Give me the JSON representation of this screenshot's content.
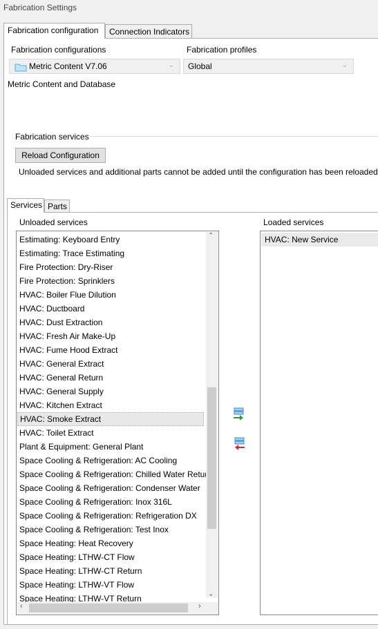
{
  "window": {
    "title": "Fabrication Settings"
  },
  "tabs": [
    "Fabrication configuration",
    "Connection Indicators"
  ],
  "config": {
    "configurations_label": "Fabrication configurations",
    "configuration_value": "Metric Content V7.06",
    "profiles_label": "Fabrication profiles",
    "profile_value": "Global",
    "description": "Metric Content and Database"
  },
  "services_group": {
    "label": "Fabrication services",
    "reload_button": "Reload Configuration",
    "note": "Unloaded services and additional parts cannot be added until the configuration has been reloaded"
  },
  "sub_tabs": [
    "Services",
    "Parts"
  ],
  "unloaded": {
    "label": "Unloaded services",
    "items": [
      "Estimating: Keyboard Entry",
      "Estimating: Trace Estimating",
      "Fire Protection: Dry-Riser",
      "Fire Protection: Sprinklers",
      "HVAC: Boiler Flue Dilution",
      "HVAC: Ductboard",
      "HVAC: Dust Extraction",
      "HVAC: Fresh Air Make-Up",
      "HVAC: Fume Hood Extract",
      "HVAC: General Extract",
      "HVAC: General Return",
      "HVAC: General Supply",
      "HVAC: Kitchen Extract",
      "HVAC: Smoke Extract",
      "HVAC: Toilet Extract",
      "Plant & Equipment: General Plant",
      "Space Cooling & Refrigeration: AC Cooling",
      "Space Cooling & Refrigeration: Chilled Water Retur",
      "Space Cooling & Refrigeration: Condenser Water",
      "Space Cooling & Refrigeration: Inox 316L",
      "Space Cooling & Refrigeration: Refrigeration DX",
      "Space Cooling & Refrigeration: Test Inox",
      "Space Heating: Heat Recovery",
      "Space Heating: LTHW-CT Flow",
      "Space Heating: LTHW-CT Return",
      "Space Heating: LTHW-VT Flow",
      "Space Heating: LTHW-VT Return"
    ],
    "selected_item": "HVAC: Smoke Extract"
  },
  "loaded": {
    "label": "Loaded services",
    "items": [
      "HVAC: New Service"
    ]
  },
  "icons": {
    "folder": "folder-icon",
    "add": "move-right-icon",
    "remove": "move-left-icon"
  }
}
